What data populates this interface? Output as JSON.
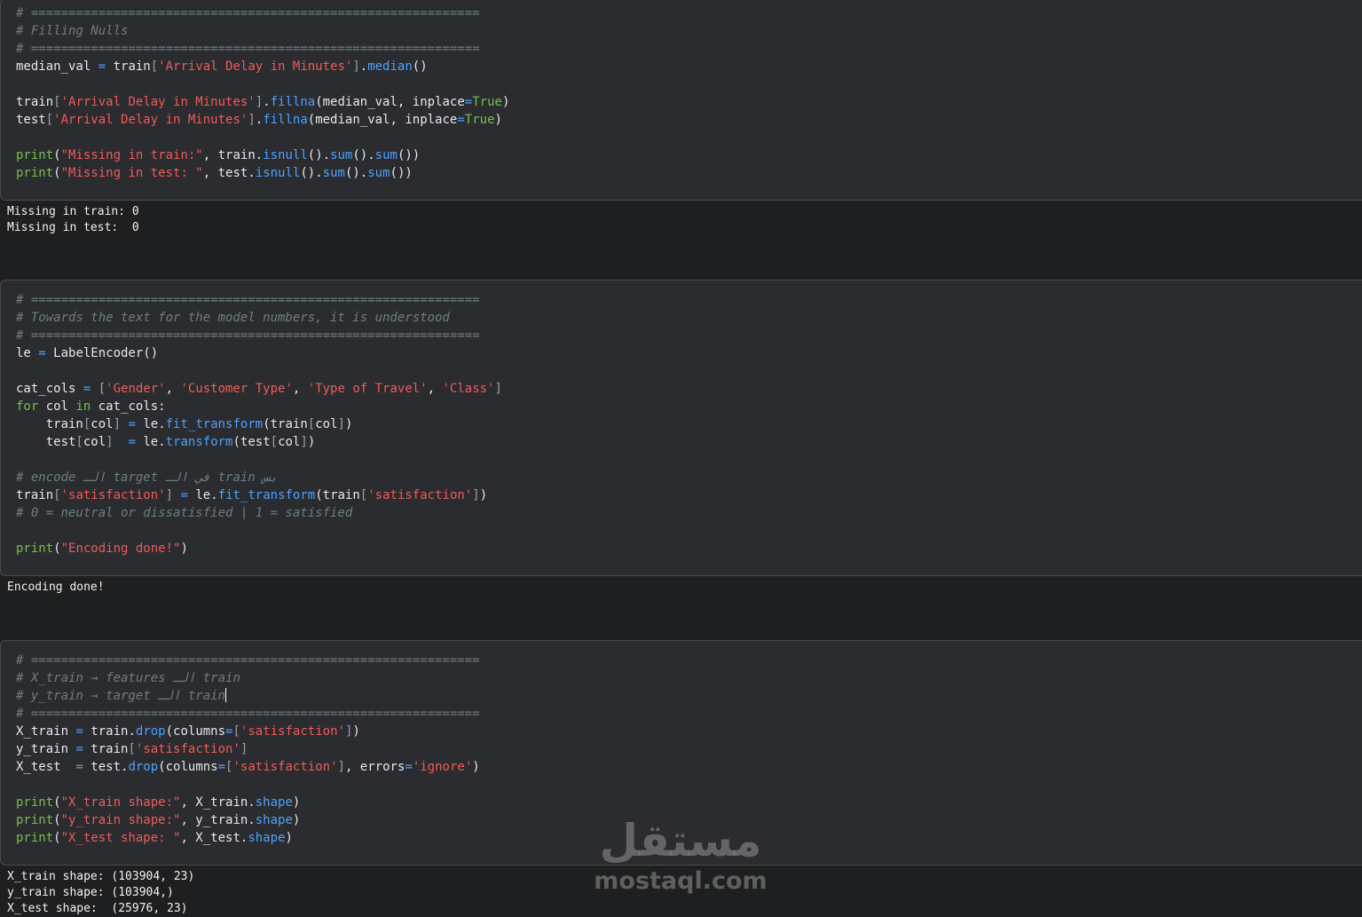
{
  "cells": [
    {
      "lines": [
        [
          {
            "t": "# ============================================================",
            "c": "cm"
          }
        ],
        [
          {
            "t": "# Filling Nulls",
            "c": "cm"
          }
        ],
        [
          {
            "t": "# ============================================================",
            "c": "cm"
          }
        ],
        [
          {
            "t": "median_val ",
            "c": "pl"
          },
          {
            "t": "=",
            "c": "op"
          },
          {
            "t": " train",
            "c": "pl"
          },
          {
            "t": "[",
            "c": "br"
          },
          {
            "t": "'Arrival Delay in Minutes'",
            "c": "str"
          },
          {
            "t": "]",
            "c": "br"
          },
          {
            "t": ".",
            "c": "pl"
          },
          {
            "t": "median",
            "c": "fn"
          },
          {
            "t": "()",
            "c": "pl"
          }
        ],
        [],
        [
          {
            "t": "train",
            "c": "pl"
          },
          {
            "t": "[",
            "c": "br"
          },
          {
            "t": "'Arrival Delay in Minutes'",
            "c": "str"
          },
          {
            "t": "]",
            "c": "br"
          },
          {
            "t": ".",
            "c": "pl"
          },
          {
            "t": "fillna",
            "c": "fn"
          },
          {
            "t": "(median_val, inplace",
            "c": "pl"
          },
          {
            "t": "=",
            "c": "op"
          },
          {
            "t": "True",
            "c": "kw"
          },
          {
            "t": ")",
            "c": "pl"
          }
        ],
        [
          {
            "t": "test",
            "c": "pl"
          },
          {
            "t": "[",
            "c": "br"
          },
          {
            "t": "'Arrival Delay in Minutes'",
            "c": "str"
          },
          {
            "t": "]",
            "c": "br"
          },
          {
            "t": ".",
            "c": "pl"
          },
          {
            "t": "fillna",
            "c": "fn"
          },
          {
            "t": "(median_val, inplace",
            "c": "pl"
          },
          {
            "t": "=",
            "c": "op"
          },
          {
            "t": "True",
            "c": "kw"
          },
          {
            "t": ")",
            "c": "pl"
          }
        ],
        [],
        [
          {
            "t": "print",
            "c": "kw"
          },
          {
            "t": "(",
            "c": "pl"
          },
          {
            "t": "\"Missing in train:\"",
            "c": "str"
          },
          {
            "t": ", train.",
            "c": "pl"
          },
          {
            "t": "isnull",
            "c": "fn"
          },
          {
            "t": "().",
            "c": "pl"
          },
          {
            "t": "sum",
            "c": "fn"
          },
          {
            "t": "().",
            "c": "pl"
          },
          {
            "t": "sum",
            "c": "fn"
          },
          {
            "t": "())",
            "c": "pl"
          }
        ],
        [
          {
            "t": "print",
            "c": "kw"
          },
          {
            "t": "(",
            "c": "pl"
          },
          {
            "t": "\"Missing in test: \"",
            "c": "str"
          },
          {
            "t": ", test.",
            "c": "pl"
          },
          {
            "t": "isnull",
            "c": "fn"
          },
          {
            "t": "().",
            "c": "pl"
          },
          {
            "t": "sum",
            "c": "fn"
          },
          {
            "t": "().",
            "c": "pl"
          },
          {
            "t": "sum",
            "c": "fn"
          },
          {
            "t": "())",
            "c": "pl"
          }
        ]
      ],
      "output": "Missing in train: 0\nMissing in test:  0"
    },
    {
      "lines": [
        [
          {
            "t": "# ============================================================",
            "c": "cm"
          }
        ],
        [
          {
            "t": "# Towards the text for the model numbers, it is understood",
            "c": "cm"
          }
        ],
        [
          {
            "t": "# ============================================================",
            "c": "cm"
          }
        ],
        [
          {
            "t": "le ",
            "c": "pl"
          },
          {
            "t": "=",
            "c": "op"
          },
          {
            "t": " LabelEncoder()",
            "c": "pl"
          }
        ],
        [],
        [
          {
            "t": "cat_cols ",
            "c": "pl"
          },
          {
            "t": "=",
            "c": "op"
          },
          {
            "t": " ",
            "c": "pl"
          },
          {
            "t": "[",
            "c": "br"
          },
          {
            "t": "'Gender'",
            "c": "str"
          },
          {
            "t": ", ",
            "c": "pl"
          },
          {
            "t": "'Customer Type'",
            "c": "str"
          },
          {
            "t": ", ",
            "c": "pl"
          },
          {
            "t": "'Type of Travel'",
            "c": "str"
          },
          {
            "t": ", ",
            "c": "pl"
          },
          {
            "t": "'Class'",
            "c": "str"
          },
          {
            "t": "]",
            "c": "br"
          }
        ],
        [
          {
            "t": "for",
            "c": "kw"
          },
          {
            "t": " col ",
            "c": "pl"
          },
          {
            "t": "in",
            "c": "kw"
          },
          {
            "t": " cat_cols:",
            "c": "pl"
          }
        ],
        [
          {
            "t": "    train",
            "c": "pl"
          },
          {
            "t": "[",
            "c": "br"
          },
          {
            "t": "col",
            "c": "pl"
          },
          {
            "t": "]",
            "c": "br"
          },
          {
            "t": " ",
            "c": "pl"
          },
          {
            "t": "=",
            "c": "op"
          },
          {
            "t": " le.",
            "c": "pl"
          },
          {
            "t": "fit_transform",
            "c": "fn"
          },
          {
            "t": "(train",
            "c": "pl"
          },
          {
            "t": "[",
            "c": "br"
          },
          {
            "t": "col",
            "c": "pl"
          },
          {
            "t": "]",
            "c": "br"
          },
          {
            "t": ")",
            "c": "pl"
          }
        ],
        [
          {
            "t": "    test",
            "c": "pl"
          },
          {
            "t": "[",
            "c": "br"
          },
          {
            "t": "col",
            "c": "pl"
          },
          {
            "t": "]",
            "c": "br"
          },
          {
            "t": "  ",
            "c": "pl"
          },
          {
            "t": "=",
            "c": "op"
          },
          {
            "t": " le.",
            "c": "pl"
          },
          {
            "t": "transform",
            "c": "fn"
          },
          {
            "t": "(test",
            "c": "pl"
          },
          {
            "t": "[",
            "c": "br"
          },
          {
            "t": "col",
            "c": "pl"
          },
          {
            "t": "]",
            "c": "br"
          },
          {
            "t": ")",
            "c": "pl"
          }
        ],
        [],
        [
          {
            "t": "# encode الـ target في الـ train بس",
            "c": "cm"
          }
        ],
        [
          {
            "t": "train",
            "c": "pl"
          },
          {
            "t": "[",
            "c": "br"
          },
          {
            "t": "'satisfaction'",
            "c": "str"
          },
          {
            "t": "]",
            "c": "br"
          },
          {
            "t": " ",
            "c": "pl"
          },
          {
            "t": "=",
            "c": "op"
          },
          {
            "t": " le.",
            "c": "pl"
          },
          {
            "t": "fit_transform",
            "c": "fn"
          },
          {
            "t": "(train",
            "c": "pl"
          },
          {
            "t": "[",
            "c": "br"
          },
          {
            "t": "'satisfaction'",
            "c": "str"
          },
          {
            "t": "]",
            "c": "br"
          },
          {
            "t": ")",
            "c": "pl"
          }
        ],
        [
          {
            "t": "# 0 = neutral or dissatisfied | 1 = satisfied",
            "c": "cm"
          }
        ],
        [],
        [
          {
            "t": "print",
            "c": "kw"
          },
          {
            "t": "(",
            "c": "pl"
          },
          {
            "t": "\"Encoding done!\"",
            "c": "str"
          },
          {
            "t": ")",
            "c": "pl"
          }
        ]
      ],
      "output": "Encoding done!"
    },
    {
      "lines": [
        [
          {
            "t": "# ============================================================",
            "c": "cm"
          }
        ],
        [
          {
            "t": "# X_train → features الـ train",
            "c": "cm"
          }
        ],
        [
          {
            "t": "# y_train → target الـ train",
            "c": "cm"
          },
          {
            "t": "",
            "c": "caret"
          }
        ],
        [
          {
            "t": "# ============================================================",
            "c": "cm"
          }
        ],
        [
          {
            "t": "X_train ",
            "c": "pl"
          },
          {
            "t": "=",
            "c": "op"
          },
          {
            "t": " train.",
            "c": "pl"
          },
          {
            "t": "drop",
            "c": "fn"
          },
          {
            "t": "(columns",
            "c": "pl"
          },
          {
            "t": "=",
            "c": "op"
          },
          {
            "t": "[",
            "c": "br"
          },
          {
            "t": "'satisfaction'",
            "c": "str"
          },
          {
            "t": "]",
            "c": "br"
          },
          {
            "t": ")",
            "c": "pl"
          }
        ],
        [
          {
            "t": "y_train ",
            "c": "pl"
          },
          {
            "t": "=",
            "c": "op"
          },
          {
            "t": " train",
            "c": "pl"
          },
          {
            "t": "[",
            "c": "br"
          },
          {
            "t": "'satisfaction'",
            "c": "str"
          },
          {
            "t": "]",
            "c": "br"
          }
        ],
        [
          {
            "t": "X_test  ",
            "c": "pl"
          },
          {
            "t": "=",
            "c": "op"
          },
          {
            "t": " test.",
            "c": "pl"
          },
          {
            "t": "drop",
            "c": "fn"
          },
          {
            "t": "(columns",
            "c": "pl"
          },
          {
            "t": "=",
            "c": "op"
          },
          {
            "t": "[",
            "c": "br"
          },
          {
            "t": "'satisfaction'",
            "c": "str"
          },
          {
            "t": "]",
            "c": "br"
          },
          {
            "t": ", errors",
            "c": "pl"
          },
          {
            "t": "=",
            "c": "op"
          },
          {
            "t": "'ignore'",
            "c": "str"
          },
          {
            "t": ")",
            "c": "pl"
          }
        ],
        [],
        [
          {
            "t": "print",
            "c": "kw"
          },
          {
            "t": "(",
            "c": "pl"
          },
          {
            "t": "\"X_train shape:\"",
            "c": "str"
          },
          {
            "t": ", X_train.",
            "c": "pl"
          },
          {
            "t": "shape",
            "c": "fn"
          },
          {
            "t": ")",
            "c": "pl"
          }
        ],
        [
          {
            "t": "print",
            "c": "kw"
          },
          {
            "t": "(",
            "c": "pl"
          },
          {
            "t": "\"y_train shape:\"",
            "c": "str"
          },
          {
            "t": ", y_train.",
            "c": "pl"
          },
          {
            "t": "shape",
            "c": "fn"
          },
          {
            "t": ")",
            "c": "pl"
          }
        ],
        [
          {
            "t": "print",
            "c": "kw"
          },
          {
            "t": "(",
            "c": "pl"
          },
          {
            "t": "\"X_test shape: \"",
            "c": "str"
          },
          {
            "t": ", X_test.",
            "c": "pl"
          },
          {
            "t": "shape",
            "c": "fn"
          },
          {
            "t": ")",
            "c": "pl"
          }
        ]
      ],
      "output": "X_train shape: (103904, 23)\ny_train shape: (103904,)\nX_test shape:  (25976, 23)"
    }
  ],
  "watermark": {
    "arabic": "مستقل",
    "latin": "mostaql.com"
  },
  "colors": {
    "background": "#1e1f21",
    "cell_background": "#2b2c2f",
    "comment": "#6b7f85",
    "string": "#f05b5b",
    "function": "#4ea1ff",
    "keyword": "#73c14b"
  }
}
